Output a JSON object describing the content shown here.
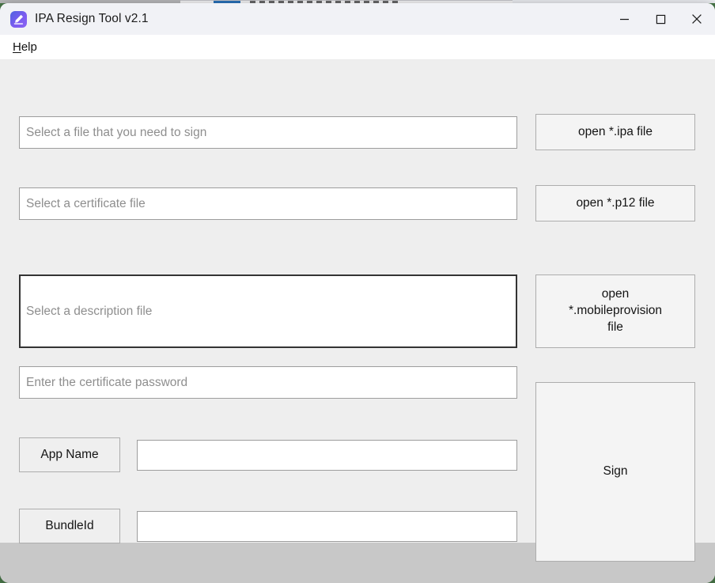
{
  "window": {
    "title": "IPA Resign Tool v2.1",
    "app_icon": "signature-pen-icon",
    "controls": {
      "minimize": "minimize-icon",
      "maximize": "maximize-icon",
      "close": "close-icon"
    }
  },
  "menubar": {
    "items": [
      {
        "label": "Help",
        "mnemonic": "H",
        "rest": "elp"
      }
    ]
  },
  "form": {
    "ipa_file": {
      "placeholder": "Select a file that you need to sign",
      "value": "",
      "button": "open *.ipa file"
    },
    "certificate_file": {
      "placeholder": "Select a certificate file",
      "value": "",
      "button": "open *.p12 file"
    },
    "description_file": {
      "placeholder": "Select a description file",
      "value": "",
      "focused": true,
      "button_line1": "open",
      "button_line2": "*.mobileprovision",
      "button_line3": "file"
    },
    "certificate_password": {
      "placeholder": "Enter the certificate password",
      "value": ""
    },
    "app_name": {
      "label": "App Name",
      "value": ""
    },
    "bundle_id": {
      "label": "BundleId",
      "value": ""
    },
    "sign_button": "Sign"
  },
  "colors": {
    "window_background": "#eeeeee",
    "titlebar": "#f1f2f6",
    "menubar": "#ffffff",
    "statusbar": "#c8c8c8",
    "field_border": "#9d9d9d",
    "field_border_focused": "#333333",
    "button_face": "#f4f4f4",
    "button_border": "#adadad",
    "placeholder_text": "#8e8e8e",
    "accent": "#6b5cf0"
  }
}
